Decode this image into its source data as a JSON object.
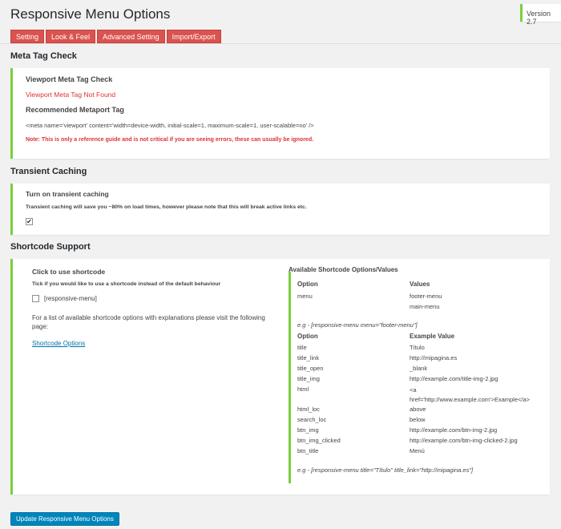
{
  "header": {
    "title": "Responsive Menu Options",
    "version": "Version 2.7"
  },
  "tabs": [
    "Setting",
    "Look & Feel",
    "Advanced Setting",
    "Import/Export"
  ],
  "meta_tag_check": {
    "heading": "Meta Tag Check",
    "viewport_label": "Viewport Meta Tag Check",
    "viewport_status": "Viewport Meta Tag Not Found",
    "recommended_label": "Recommended Metaport Tag",
    "recommended_code": "<meta name='viewport' content='width=device-width, initial-scale=1, maximum-scale=1, user-scalable=no' />",
    "note": "Note: This is only a reference guide and is not critical if you are seeing errors, these can usually be ignored."
  },
  "transient_caching": {
    "heading": "Transient Caching",
    "label": "Turn on transient caching",
    "description": "Transient caching will save you ~80% on load times, however please note that this will break active links etc.",
    "checked_mark": "✔"
  },
  "shortcode_support": {
    "heading": "Shortcode Support",
    "label": "Click to use shortcode",
    "description": "Tick if you would like to use a shortcode instead of the default behaviour",
    "checkbox_label": "[responsive-menu]",
    "info_text": "For a list of available shortcode options with explanations please visit the following page:",
    "link_text": "Shortcode Options",
    "available_title": "Available Shortcode Options/Values",
    "table1": {
      "headers": [
        "Option",
        "Values"
      ],
      "option": "menu",
      "values": [
        "footer-menu",
        "main-menu"
      ]
    },
    "example1": "e.g - [responsive-menu menu=\"footer-menu\"]",
    "table2": {
      "headers": [
        "Option",
        "Example Value"
      ],
      "rows": [
        [
          "title",
          "Título"
        ],
        [
          "title_link",
          "http://mipagina.es"
        ],
        [
          "title_open",
          "_blank"
        ],
        [
          "title_img",
          "http://example.com/title-img-2.jpg"
        ],
        [
          "html",
          "<a href='http://www.example.com'>Example</a>"
        ],
        [
          "html_loc",
          "above"
        ],
        [
          "search_loc",
          "below"
        ],
        [
          "btn_img",
          "http://example.com/btn-img-2.jpg"
        ],
        [
          "btn_img_clicked",
          "http://example.com/btn-img-clicked-2.jpg"
        ],
        [
          "btn_title",
          "Menú"
        ]
      ]
    },
    "example2": "e.g - [responsive-menu title=\"Título\" title_link=\"http://mipagina.es\"]"
  },
  "update_button": "Update Responsive Menu Options"
}
